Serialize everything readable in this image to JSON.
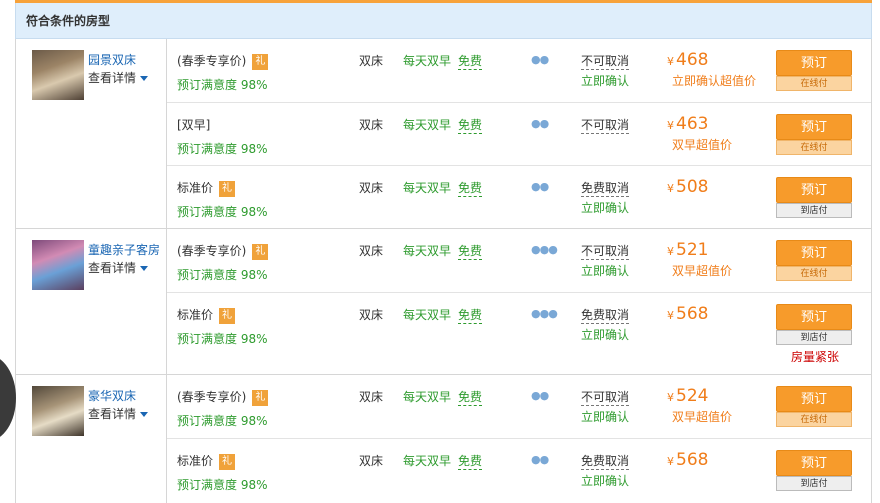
{
  "header": {
    "title": "符合条件的房型"
  },
  "common": {
    "bed": "双床",
    "breakfast": "每天双早",
    "wifi": "免费",
    "satisfaction": "预订满意度 98%",
    "gift_icon": "礼",
    "confirm": "立即确认",
    "book_label": "预订",
    "pay_online": "在线付",
    "pay_store": "到店付",
    "currency": "¥",
    "detail": "查看详情"
  },
  "rooms": [
    {
      "name": "园景双床",
      "rows": [
        {
          "plan": "(春季专享价)",
          "cancel": "不可取消",
          "confirm": "立即确认",
          "price": "468",
          "promo": "立即确认超值价",
          "pay": "在线付",
          "occupancy": "2"
        },
        {
          "plan": "[双早]",
          "cancel": "不可取消",
          "confirm": "",
          "price": "463",
          "promo": "双早超值价",
          "pay": "在线付",
          "occupancy": "2"
        },
        {
          "plan": "标准价",
          "cancel": "免费取消",
          "confirm": "立即确认",
          "price": "508",
          "promo": "",
          "pay": "到店付",
          "occupancy": "2"
        }
      ]
    },
    {
      "name": "童趣亲子客房",
      "rows": [
        {
          "plan": "(春季专享价)",
          "cancel": "不可取消",
          "confirm": "立即确认",
          "price": "521",
          "promo": "双早超值价",
          "pay": "在线付",
          "occupancy": "3"
        },
        {
          "plan": "标准价",
          "cancel": "免费取消",
          "confirm": "立即确认",
          "price": "568",
          "promo": "",
          "pay": "到店付",
          "occupancy": "3",
          "note": "房量紧张"
        }
      ]
    },
    {
      "name": "豪华双床",
      "rows": [
        {
          "plan": "(春季专享价)",
          "cancel": "不可取消",
          "confirm": "立即确认",
          "price": "524",
          "promo": "双早超值价",
          "pay": "在线付",
          "occupancy": "2"
        },
        {
          "plan": "标准价",
          "cancel": "免费取消",
          "confirm": "立即确认",
          "price": "568",
          "promo": "",
          "pay": "到店付",
          "occupancy": "2"
        }
      ]
    }
  ]
}
